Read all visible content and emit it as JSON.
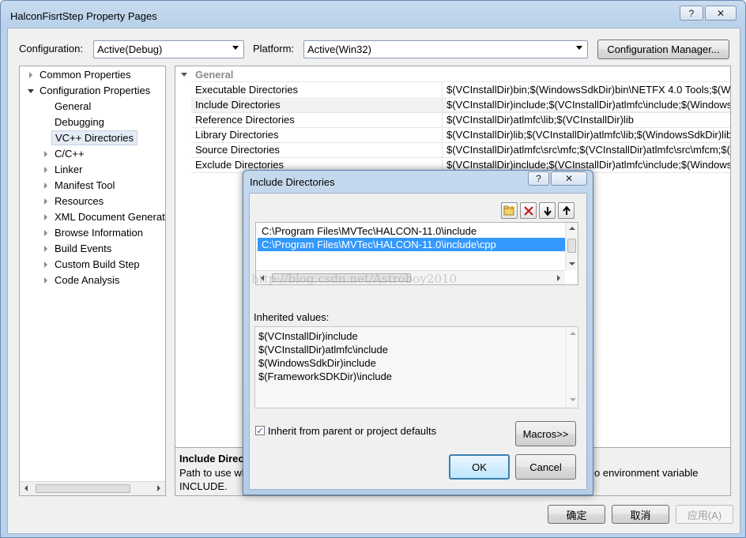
{
  "window": {
    "title": "HalconFisrtStep Property Pages",
    "help_glyph": "?",
    "close_glyph": "✕"
  },
  "toolbar": {
    "configuration_label": "Configuration:",
    "configuration_value": "Active(Debug)",
    "platform_label": "Platform:",
    "platform_value": "Active(Win32)",
    "config_manager_label": "Configuration Manager..."
  },
  "tree": {
    "items": [
      {
        "label": "Common Properties"
      },
      {
        "label": "Configuration Properties"
      },
      {
        "label": "General"
      },
      {
        "label": "Debugging"
      },
      {
        "label": "VC++ Directories"
      },
      {
        "label": "C/C++"
      },
      {
        "label": "Linker"
      },
      {
        "label": "Manifest Tool"
      },
      {
        "label": "Resources"
      },
      {
        "label": "XML Document Generat"
      },
      {
        "label": "Browse Information"
      },
      {
        "label": "Build Events"
      },
      {
        "label": "Custom Build Step"
      },
      {
        "label": "Code Analysis"
      }
    ]
  },
  "grid": {
    "category": "General",
    "rows": [
      {
        "name": "Executable Directories",
        "value": "$(VCInstallDir)bin;$(WindowsSdkDir)bin\\NETFX 4.0 Tools;$(Wi"
      },
      {
        "name": "Include Directories",
        "value": "$(VCInstallDir)include;$(VCInstallDir)atlmfc\\include;$(WindowsS"
      },
      {
        "name": "Reference Directories",
        "value": "$(VCInstallDir)atlmfc\\lib;$(VCInstallDir)lib"
      },
      {
        "name": "Library Directories",
        "value": "$(VCInstallDir)lib;$(VCInstallDir)atlmfc\\lib;$(WindowsSdkDir)lib"
      },
      {
        "name": "Source Directories",
        "value": "$(VCInstallDir)atlmfc\\src\\mfc;$(VCInstallDir)atlmfc\\src\\mfcm;$("
      },
      {
        "name": "Exclude Directories",
        "value": "$(VCInstallDir)include;$(VCInstallDir)atlmfc\\include;$(WindowsS"
      }
    ]
  },
  "description": {
    "title": "Include Direc",
    "line1_left": "Path to use wh",
    "line1_right": "o environment variable",
    "line2": "INCLUDE."
  },
  "footer": {
    "ok": "确定",
    "cancel": "取消",
    "apply": "应用(A)"
  },
  "dialog": {
    "title": "Include Directories",
    "entries": [
      "C:\\Program Files\\MVTec\\HALCON-11.0\\include",
      "C:\\Program Files\\MVTec\\HALCON-11.0\\include\\cpp"
    ],
    "selected_index": 1,
    "watermark": "http://blog.csdn.net/Astroboy2010",
    "inherited_label": "Inherited values:",
    "inherited": [
      "$(VCInstallDir)include",
      "$(VCInstallDir)atlmfc\\include",
      "$(WindowsSdkDir)include",
      "$(FrameworkSDKDir)\\include"
    ],
    "inherit_checkbox_label": "Inherit from parent or project defaults",
    "inherit_checked": true,
    "macros_label": "Macros>>",
    "ok_label": "OK",
    "cancel_label": "Cancel"
  }
}
